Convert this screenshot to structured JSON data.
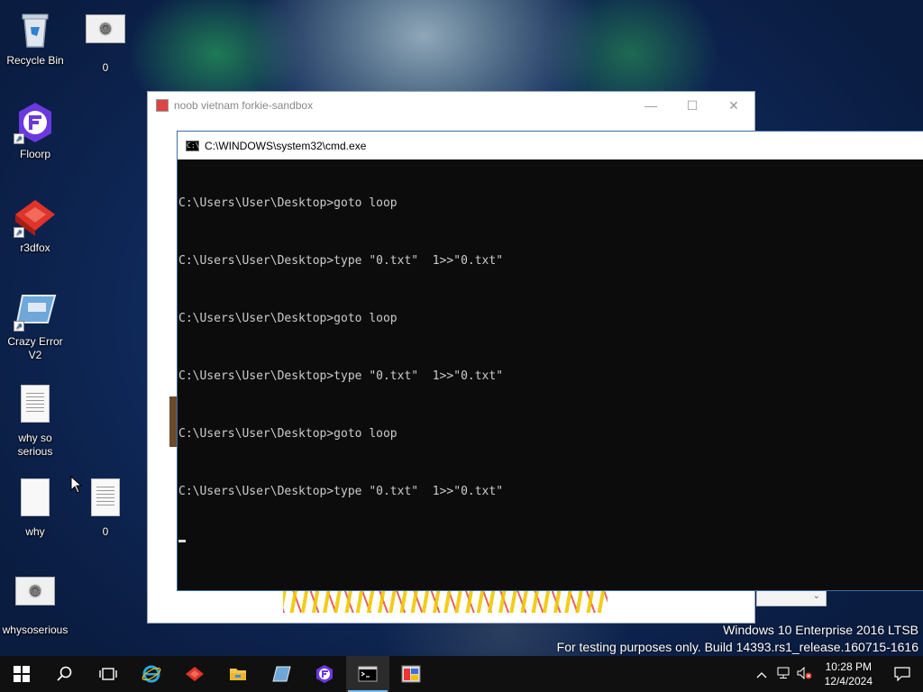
{
  "desktop": {
    "icons": [
      {
        "label": "Recycle Bin",
        "icon": "recycle-bin-icon"
      },
      {
        "label": "0",
        "icon": "settings-file-icon"
      },
      {
        "label": "Floorp",
        "icon": "floorp-icon"
      },
      {
        "label": "r3dfox",
        "icon": "r3dfox-icon"
      },
      {
        "label": "Crazy Error V2",
        "icon": "crazy-error-icon"
      },
      {
        "label": "why so serious",
        "icon": "text-file-icon"
      },
      {
        "label": "why",
        "icon": "blank-file-icon"
      },
      {
        "label": "0",
        "icon": "text-file-icon"
      },
      {
        "label": "whysoserious",
        "icon": "settings-file-icon"
      }
    ]
  },
  "back_window": {
    "title": "noob vietnam forkie-sandbox",
    "minimize": "—",
    "maximize": "☐",
    "close": "✕",
    "dropdown_arrow": "⌄"
  },
  "cmd_window": {
    "title": "C:\\WINDOWS\\system32\\cmd.exe",
    "icon_text": "C:\\",
    "lines": [
      "C:\\Users\\User\\Desktop>goto loop",
      "C:\\Users\\User\\Desktop>type \"0.txt\"  1>>\"0.txt\"",
      "C:\\Users\\User\\Desktop>goto loop",
      "C:\\Users\\User\\Desktop>type \"0.txt\"  1>>\"0.txt\"",
      "C:\\Users\\User\\Desktop>goto loop",
      "C:\\Users\\User\\Desktop>type \"0.txt\"  1>>\"0.txt\""
    ]
  },
  "watermark": {
    "line1": "Windows 10 Enterprise 2016 LTSB",
    "line2": "For testing purposes only. Build 14393.rs1_release.160715-1616"
  },
  "taskbar": {
    "apps": [
      {
        "name": "internet-explorer",
        "active": false
      },
      {
        "name": "r3dfox",
        "active": false
      },
      {
        "name": "file-explorer",
        "active": false
      },
      {
        "name": "crazy-error",
        "active": false
      },
      {
        "name": "floorp",
        "active": false
      },
      {
        "name": "command-prompt",
        "active": true
      },
      {
        "name": "sandbox-app",
        "active": false
      }
    ],
    "clock_time": "10:28 PM",
    "clock_date": "12/4/2024"
  },
  "colors": {
    "taskbar_bg": "#101010",
    "cmd_bg": "#0c0c0c",
    "cmd_text": "#cccccc",
    "accent": "#76b9ed"
  }
}
